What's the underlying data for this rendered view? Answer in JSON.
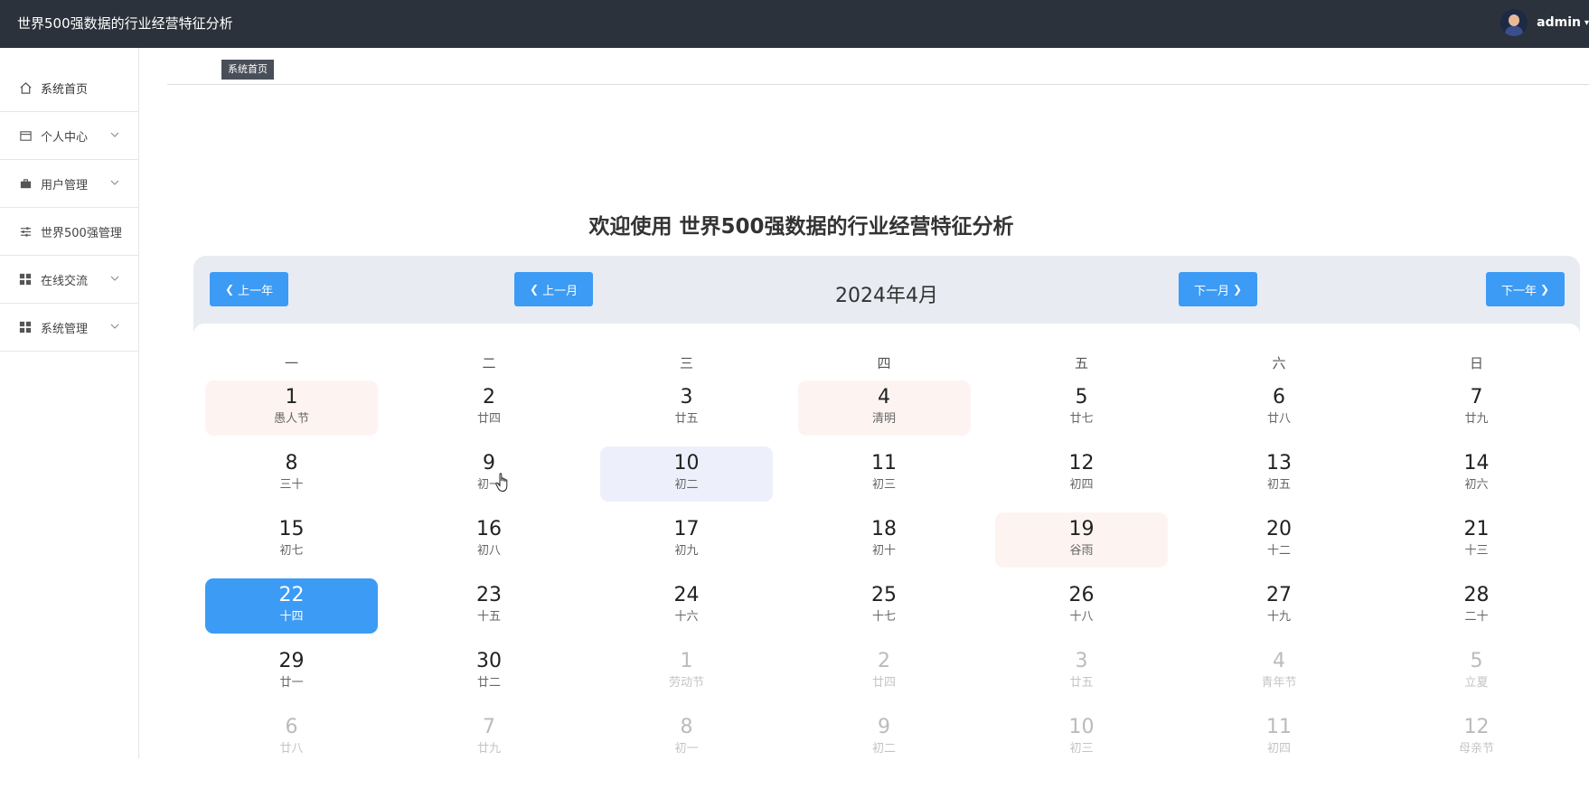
{
  "app": {
    "title": "世界500强数据的行业经营特征分析"
  },
  "user": {
    "name": "admin"
  },
  "sidebar": {
    "items": [
      {
        "label": "系统首页",
        "icon": "home-icon",
        "expandable": false
      },
      {
        "label": "个人中心",
        "icon": "card-icon",
        "expandable": true
      },
      {
        "label": "用户管理",
        "icon": "briefcase-icon",
        "expandable": true
      },
      {
        "label": "世界500强管理",
        "icon": "sliders-icon",
        "expandable": false
      },
      {
        "label": "在线交流",
        "icon": "grid-icon",
        "expandable": true
      },
      {
        "label": "系统管理",
        "icon": "grid-icon",
        "expandable": true
      }
    ]
  },
  "breadcrumb": {
    "tag": "系统首页"
  },
  "welcome": {
    "text": "欢迎使用 世界500强数据的行业经营特征分析"
  },
  "calendar": {
    "title": "2024年4月",
    "prev_year": "上一年",
    "prev_month": "上一月",
    "next_month": "下一月",
    "next_year": "下一年",
    "weekdays": [
      "一",
      "二",
      "三",
      "四",
      "五",
      "六",
      "日"
    ],
    "days": [
      {
        "num": "1",
        "lunar": "愚人节",
        "state": "holiday"
      },
      {
        "num": "2",
        "lunar": "廿四",
        "state": ""
      },
      {
        "num": "3",
        "lunar": "廿五",
        "state": ""
      },
      {
        "num": "4",
        "lunar": "清明",
        "state": "holiday"
      },
      {
        "num": "5",
        "lunar": "廿七",
        "state": ""
      },
      {
        "num": "6",
        "lunar": "廿八",
        "state": ""
      },
      {
        "num": "7",
        "lunar": "廿九",
        "state": ""
      },
      {
        "num": "8",
        "lunar": "三十",
        "state": ""
      },
      {
        "num": "9",
        "lunar": "初一",
        "state": ""
      },
      {
        "num": "10",
        "lunar": "初二",
        "state": "today"
      },
      {
        "num": "11",
        "lunar": "初三",
        "state": ""
      },
      {
        "num": "12",
        "lunar": "初四",
        "state": ""
      },
      {
        "num": "13",
        "lunar": "初五",
        "state": ""
      },
      {
        "num": "14",
        "lunar": "初六",
        "state": ""
      },
      {
        "num": "15",
        "lunar": "初七",
        "state": ""
      },
      {
        "num": "16",
        "lunar": "初八",
        "state": ""
      },
      {
        "num": "17",
        "lunar": "初九",
        "state": ""
      },
      {
        "num": "18",
        "lunar": "初十",
        "state": ""
      },
      {
        "num": "19",
        "lunar": "谷雨",
        "state": "holiday"
      },
      {
        "num": "20",
        "lunar": "十二",
        "state": ""
      },
      {
        "num": "21",
        "lunar": "十三",
        "state": ""
      },
      {
        "num": "22",
        "lunar": "十四",
        "state": "selected"
      },
      {
        "num": "23",
        "lunar": "十五",
        "state": ""
      },
      {
        "num": "24",
        "lunar": "十六",
        "state": ""
      },
      {
        "num": "25",
        "lunar": "十七",
        "state": ""
      },
      {
        "num": "26",
        "lunar": "十八",
        "state": ""
      },
      {
        "num": "27",
        "lunar": "十九",
        "state": ""
      },
      {
        "num": "28",
        "lunar": "二十",
        "state": ""
      },
      {
        "num": "29",
        "lunar": "廿一",
        "state": ""
      },
      {
        "num": "30",
        "lunar": "廿二",
        "state": ""
      },
      {
        "num": "1",
        "lunar": "劳动节",
        "state": "other"
      },
      {
        "num": "2",
        "lunar": "廿四",
        "state": "other"
      },
      {
        "num": "3",
        "lunar": "廿五",
        "state": "other"
      },
      {
        "num": "4",
        "lunar": "青年节",
        "state": "other"
      },
      {
        "num": "5",
        "lunar": "立夏",
        "state": "other"
      },
      {
        "num": "6",
        "lunar": "廿八",
        "state": "other"
      },
      {
        "num": "7",
        "lunar": "廿九",
        "state": "other"
      },
      {
        "num": "8",
        "lunar": "初一",
        "state": "other"
      },
      {
        "num": "9",
        "lunar": "初二",
        "state": "other"
      },
      {
        "num": "10",
        "lunar": "初三",
        "state": "other"
      },
      {
        "num": "11",
        "lunar": "初四",
        "state": "other"
      },
      {
        "num": "12",
        "lunar": "母亲节",
        "state": "other"
      }
    ]
  },
  "colors": {
    "topbar": "#2b323b",
    "accent": "#3c9bf5",
    "holiday_bg": "#fdf4f2",
    "today_bg": "#edf0fb",
    "calendar_header_bg": "#e9ebf2"
  }
}
